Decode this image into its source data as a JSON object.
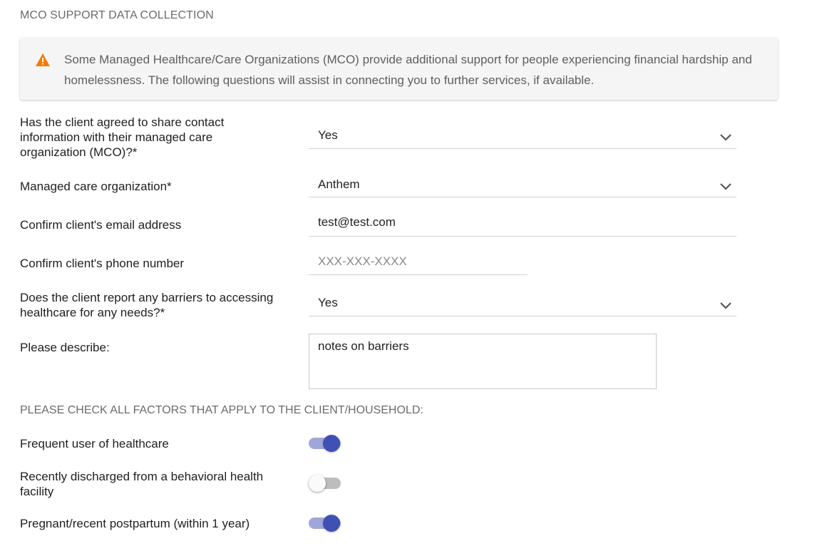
{
  "section_title": "MCO SUPPORT DATA COLLECTION",
  "alert": {
    "icon": "warning-triangle-icon",
    "icon_color": "#f57c00",
    "text": "Some Managed Healthcare/Care Organizations (MCO) provide additional support for people experiencing financial hardship and homelessness. The following questions will assist in connecting you to further services, if available."
  },
  "form": {
    "share_contact": {
      "label": "Has the client agreed to share contact information with their managed care organization (MCO)?*",
      "value": "Yes"
    },
    "mco": {
      "label": "Managed care organization*",
      "value": "Anthem"
    },
    "email": {
      "label": "Confirm client's email address",
      "value": "test@test.com"
    },
    "phone": {
      "label": "Confirm client's phone number",
      "placeholder": "XXX-XXX-XXXX",
      "value": ""
    },
    "barriers": {
      "label": "Does the client report any barriers to accessing healthcare for any needs?*",
      "value": "Yes"
    },
    "describe": {
      "label": "Please describe:",
      "value": "notes on barriers"
    }
  },
  "factors": {
    "heading": "PLEASE CHECK ALL FACTORS THAT APPLY TO THE CLIENT/HOUSEHOLD:",
    "items": [
      {
        "label": "Frequent user of healthcare",
        "checked": true
      },
      {
        "label": "Recently discharged from a behavioral health facility",
        "checked": false
      },
      {
        "label": "Pregnant/recent postpartum (within 1 year)",
        "checked": true
      }
    ]
  },
  "colors": {
    "accent": "#3f51b5",
    "accent_track": "#9fa6d9",
    "warning": "#f57c00"
  }
}
